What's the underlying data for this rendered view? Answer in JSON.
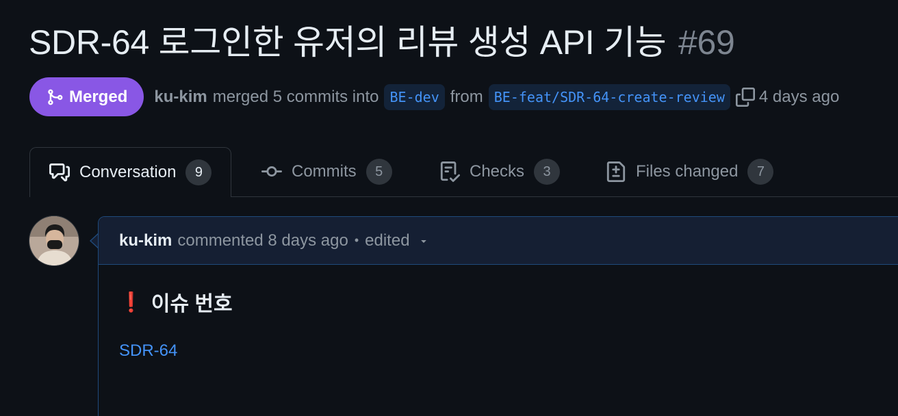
{
  "pr": {
    "title": "SDR-64 로그인한 유저의 리뷰 생성 API 기능",
    "number": "#69",
    "state": "Merged",
    "author": "ku-kim",
    "merged_text": "merged 5 commits into",
    "base_branch": "BE-dev",
    "from_text": "from",
    "head_branch": "BE-feat/SDR-64-create-review",
    "time": "4 days ago"
  },
  "tabs": [
    {
      "label": "Conversation",
      "count": "9",
      "icon": "comment-discussion-icon",
      "active": true
    },
    {
      "label": "Commits",
      "count": "5",
      "icon": "git-commit-icon",
      "active": false
    },
    {
      "label": "Checks",
      "count": "3",
      "icon": "checklist-icon",
      "active": false
    },
    {
      "label": "Files changed",
      "count": "7",
      "icon": "file-diff-icon",
      "active": false
    }
  ],
  "comment": {
    "author": "ku-kim",
    "action": "commented 8 days ago",
    "separator": "•",
    "edited": "edited",
    "heading_icon": "❗",
    "heading": "이슈 번호",
    "issue_link": "SDR-64"
  },
  "colors": {
    "background": "#0d1117",
    "merged_badge": "#8957e5",
    "link": "#4493f8",
    "muted": "#8d96a0"
  }
}
